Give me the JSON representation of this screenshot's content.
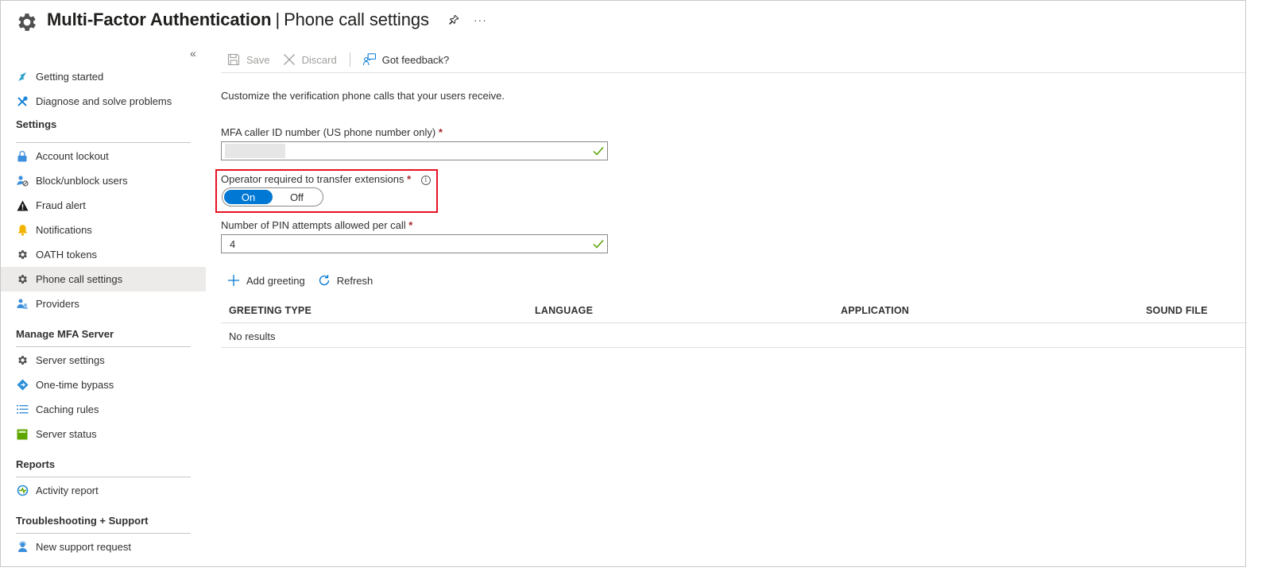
{
  "header": {
    "title": "Multi-Factor Authentication",
    "separator": "|",
    "subtitle": "Phone call settings",
    "icon": "gear-icon"
  },
  "sidebar": {
    "collapse_icon": "«",
    "items": [
      {
        "type": "item",
        "label": "Getting started",
        "icon": "quickstart-icon"
      },
      {
        "type": "item",
        "label": "Diagnose and solve problems",
        "icon": "wrench-icon"
      },
      {
        "type": "section",
        "label": "Settings"
      },
      {
        "type": "item",
        "label": "Account lockout",
        "icon": "lock-icon"
      },
      {
        "type": "item",
        "label": "Block/unblock users",
        "icon": "user-block-icon"
      },
      {
        "type": "item",
        "label": "Fraud alert",
        "icon": "warning-icon"
      },
      {
        "type": "item",
        "label": "Notifications",
        "icon": "bell-icon"
      },
      {
        "type": "item",
        "label": "OATH tokens",
        "icon": "gear-icon"
      },
      {
        "type": "item",
        "label": "Phone call settings",
        "icon": "gear-icon",
        "active": true
      },
      {
        "type": "item",
        "label": "Providers",
        "icon": "users-icon"
      },
      {
        "type": "section",
        "label": "Manage MFA Server"
      },
      {
        "type": "item",
        "label": "Server settings",
        "icon": "gear-icon"
      },
      {
        "type": "item",
        "label": "One-time bypass",
        "icon": "diamond-icon"
      },
      {
        "type": "item",
        "label": "Caching rules",
        "icon": "list-icon"
      },
      {
        "type": "item",
        "label": "Server status",
        "icon": "status-icon"
      },
      {
        "type": "section",
        "label": "Reports"
      },
      {
        "type": "item",
        "label": "Activity report",
        "icon": "activity-icon"
      },
      {
        "type": "section",
        "label": "Troubleshooting + Support"
      },
      {
        "type": "item",
        "label": "New support request",
        "icon": "support-icon"
      }
    ]
  },
  "toolbar": {
    "save_label": "Save",
    "discard_label": "Discard",
    "feedback_label": "Got feedback?"
  },
  "main": {
    "description": "Customize the verification phone calls that your users receive.",
    "caller_id": {
      "label": "MFA caller ID number (US phone number only)",
      "required_mark": "*",
      "value": ""
    },
    "operator": {
      "label": "Operator required to transfer extensions",
      "required_mark": "*",
      "info_icon": "i",
      "on_label": "On",
      "off_label": "Off",
      "selected": "On"
    },
    "pin_attempts": {
      "label": "Number of PIN attempts allowed per call",
      "required_mark": "*",
      "value": "4"
    },
    "add_greeting_label": "Add greeting",
    "refresh_label": "Refresh",
    "table": {
      "columns": [
        "GREETING TYPE",
        "LANGUAGE",
        "APPLICATION",
        "SOUND FILE"
      ],
      "empty_text": "No results"
    }
  },
  "colors": {
    "accent": "#0078d4",
    "highlight_border": "#e81123",
    "valid_check": "#57a300",
    "active_nav_bg": "#edebe9"
  }
}
